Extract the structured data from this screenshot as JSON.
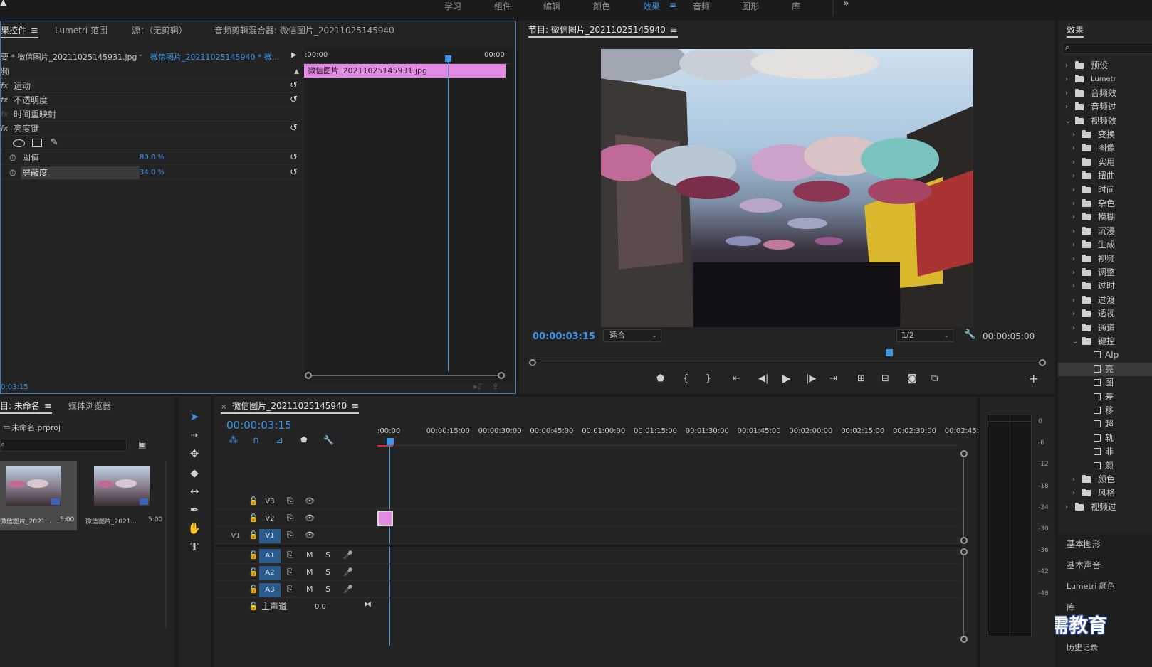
{
  "workspace": {
    "tabs": [
      "学习",
      "组件",
      "编辑",
      "颜色",
      "效果",
      "音频",
      "图形",
      "库"
    ],
    "active": "效果",
    "more": "»"
  },
  "effect_controls": {
    "tabs": [
      "果控件",
      "Lumetri 范围",
      "源：（无剪辑）",
      "音频剪辑混合器: 微信图片_20211025145940"
    ],
    "source_clip": "要 * 微信图片_20211025145931.jpg",
    "sequence_clip": "微信图片_20211025145940 * 微...",
    "section": "频",
    "effects": [
      {
        "name": "运动",
        "fx": true
      },
      {
        "name": "不透明度",
        "fx": true
      },
      {
        "name": "时间重映射",
        "fx": false
      },
      {
        "name": "亮度键",
        "fx": true
      }
    ],
    "params": [
      {
        "name": "阈值",
        "value": "80.0 %"
      },
      {
        "name": "屏蔽度",
        "value": "34.0 %"
      }
    ],
    "mini_timeline": {
      "start": ":00:00",
      "end": "00:00",
      "clip": "微信图片_20211025145931.jpg"
    },
    "timecode": "0:03:15"
  },
  "program_monitor": {
    "title": "节目: 微信图片_20211025145940",
    "timecode": "00:00:03:15",
    "fit": "适合",
    "quality": "1/2",
    "duration": "00:00:05:00",
    "playhead_fraction": 0.7
  },
  "effects_panel": {
    "title": "效果",
    "search_placeholder": "",
    "items": [
      {
        "label": "预设",
        "indent": 0,
        "open": false
      },
      {
        "label": "Lumetr",
        "indent": 0,
        "open": false
      },
      {
        "label": "音频效",
        "indent": 0,
        "open": false
      },
      {
        "label": "音频过",
        "indent": 0,
        "open": false
      },
      {
        "label": "视频效",
        "indent": 0,
        "open": true
      },
      {
        "label": "变换",
        "indent": 1,
        "open": false
      },
      {
        "label": "图像",
        "indent": 1,
        "open": false
      },
      {
        "label": "实用",
        "indent": 1,
        "open": false
      },
      {
        "label": "扭曲",
        "indent": 1,
        "open": false
      },
      {
        "label": "时间",
        "indent": 1,
        "open": false
      },
      {
        "label": "杂色",
        "indent": 1,
        "open": false
      },
      {
        "label": "模糊",
        "indent": 1,
        "open": false
      },
      {
        "label": "沉浸",
        "indent": 1,
        "open": false
      },
      {
        "label": "生成",
        "indent": 1,
        "open": false
      },
      {
        "label": "视频",
        "indent": 1,
        "open": false
      },
      {
        "label": "调整",
        "indent": 1,
        "open": false
      },
      {
        "label": "过时",
        "indent": 1,
        "open": false
      },
      {
        "label": "过渡",
        "indent": 1,
        "open": false
      },
      {
        "label": "透视",
        "indent": 1,
        "open": false
      },
      {
        "label": "通道",
        "indent": 1,
        "open": false
      },
      {
        "label": "键控",
        "indent": 1,
        "open": true
      },
      {
        "label": "Alp",
        "indent": 2,
        "open": false
      },
      {
        "label": "亮",
        "indent": 2,
        "open": false
      },
      {
        "label": "图",
        "indent": 2,
        "open": false
      },
      {
        "label": "差",
        "indent": 2,
        "open": false
      },
      {
        "label": "移",
        "indent": 2,
        "open": false
      },
      {
        "label": "超",
        "indent": 2,
        "open": false
      },
      {
        "label": "轨",
        "indent": 2,
        "open": false
      },
      {
        "label": "非",
        "indent": 2,
        "open": false
      },
      {
        "label": "颜",
        "indent": 2,
        "open": false
      },
      {
        "label": "颜色",
        "indent": 1,
        "open": false
      },
      {
        "label": "风格",
        "indent": 1,
        "open": false
      },
      {
        "label": "视频过",
        "indent": 0,
        "open": false
      }
    ],
    "side_panels": [
      "基本图形",
      "基本声音",
      "Lumetri 颜色",
      "库",
      "历史记录"
    ]
  },
  "project": {
    "tabs": [
      "目: 未命名",
      "媒体浏览器"
    ],
    "file": "未命名.prproj",
    "items": [
      {
        "name": "微信图片_2021...",
        "duration": "5:00"
      },
      {
        "name": "微信图片_2021...",
        "duration": "5:00"
      }
    ]
  },
  "timeline": {
    "title": "微信图片_20211025145940",
    "timecode": "00:00:03:15",
    "ticks": [
      ":00:00",
      "00:00:15:00",
      "00:00:30:00",
      "00:00:45:00",
      "00:01:00:00",
      "00:01:15:00",
      "00:01:30:00",
      "00:01:45:00",
      "00:02:00:00",
      "00:02:15:00",
      "00:02:30:00",
      "00:02:45:"
    ],
    "video_tracks": [
      "V3",
      "V2",
      "V1"
    ],
    "source_patch": "V1",
    "audio_tracks": [
      "A1",
      "A2",
      "A3"
    ],
    "master": {
      "label": "主声道",
      "value": "0.0"
    },
    "mute": "M",
    "solo": "S"
  },
  "meter": {
    "labels": [
      "0",
      "-6",
      "-12",
      "-18",
      "-24",
      "-30",
      "-36",
      "-42",
      "-48"
    ]
  },
  "watermark": "最需教育",
  "colors": {
    "accent": "#3f95e9",
    "clip": "#e38ae4",
    "panel": "#232323",
    "track_select": "#2b5b8d"
  }
}
